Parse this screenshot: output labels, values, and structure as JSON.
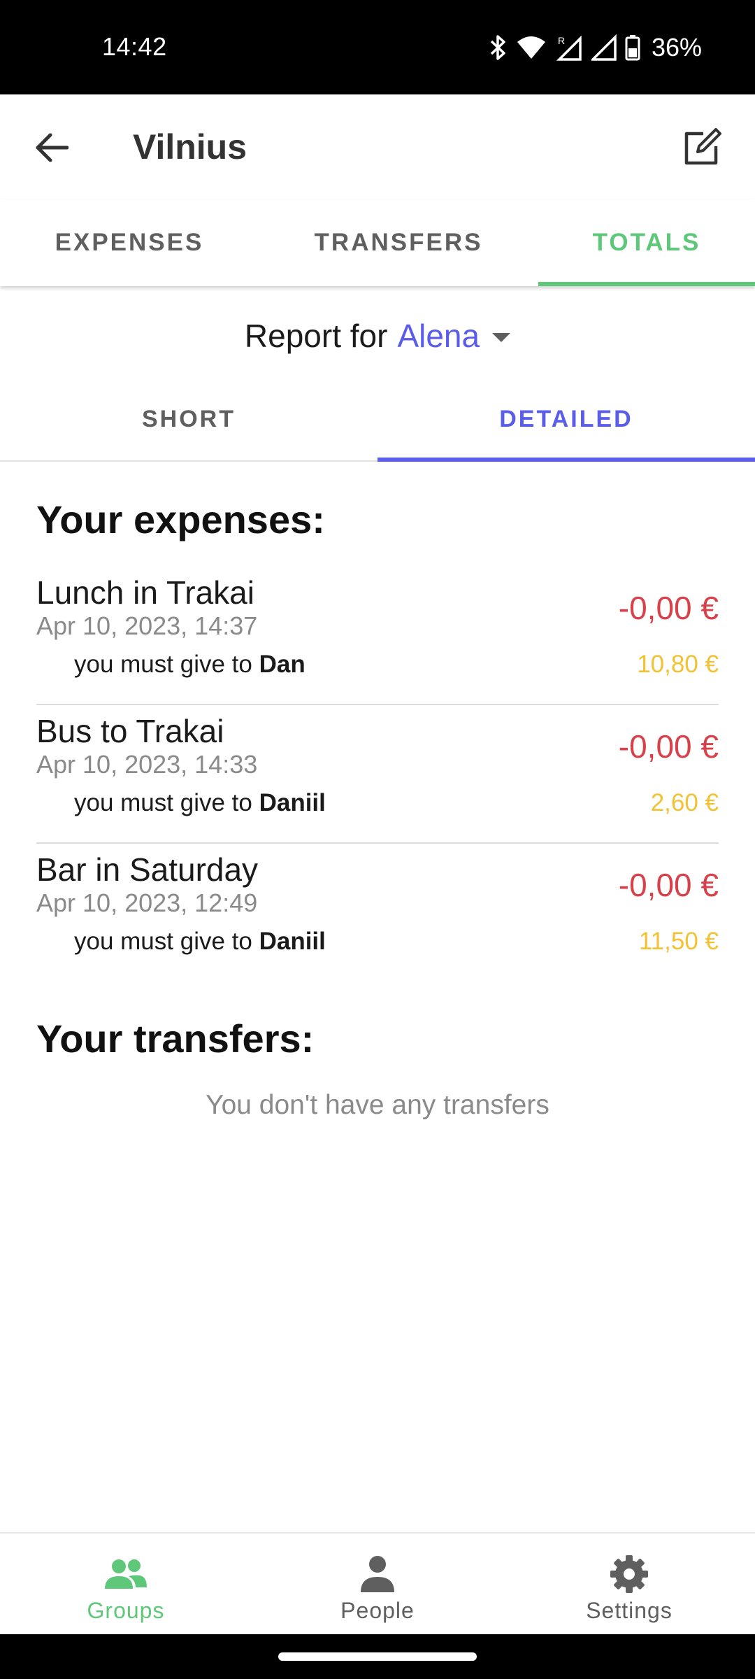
{
  "status_bar": {
    "time": "14:42",
    "battery": "36%",
    "icons": [
      "bluetooth-icon",
      "wifi-icon",
      "signal-roaming-icon",
      "signal-icon",
      "battery-icon"
    ]
  },
  "app_bar": {
    "title": "Vilnius",
    "back_icon": "arrow-left-icon",
    "edit_icon": "edit-icon"
  },
  "top_tabs": [
    {
      "label": "EXPENSES",
      "active": false
    },
    {
      "label": "TRANSFERS",
      "active": false
    },
    {
      "label": "TOTALS",
      "active": true
    }
  ],
  "report": {
    "label": "Report for",
    "person": "Alena"
  },
  "sub_tabs": [
    {
      "label": "SHORT",
      "active": false
    },
    {
      "label": "DETAILED",
      "active": true
    }
  ],
  "expenses_section": {
    "title": "Your expenses:",
    "items": [
      {
        "name": "Lunch in Trakai",
        "date": "Apr 10, 2023, 14:37",
        "amount": "-0,00 €",
        "owe_prefix": "you must give to",
        "owe_person": "Dan",
        "owe_amount": "10,80 €"
      },
      {
        "name": "Bus to Trakai",
        "date": "Apr 10, 2023, 14:33",
        "amount": "-0,00 €",
        "owe_prefix": "you must give to",
        "owe_person": "Daniil",
        "owe_amount": "2,60 €"
      },
      {
        "name": "Bar in Saturday",
        "date": "Apr 10, 2023, 12:49",
        "amount": "-0,00 €",
        "owe_prefix": "you must give to",
        "owe_person": "Daniil",
        "owe_amount": "11,50 €"
      }
    ]
  },
  "transfers_section": {
    "title": "Your transfers:",
    "empty": "You don't have any transfers"
  },
  "bottom_nav": [
    {
      "label": "Groups",
      "icon": "groups-icon",
      "active": true
    },
    {
      "label": "People",
      "icon": "person-icon",
      "active": false
    },
    {
      "label": "Settings",
      "icon": "gear-icon",
      "active": false
    }
  ],
  "colors": {
    "accent_green": "#5ec77a",
    "accent_blue": "#5a5de8",
    "negative_red": "#d9414a",
    "owe_yellow": "#f2c232"
  }
}
